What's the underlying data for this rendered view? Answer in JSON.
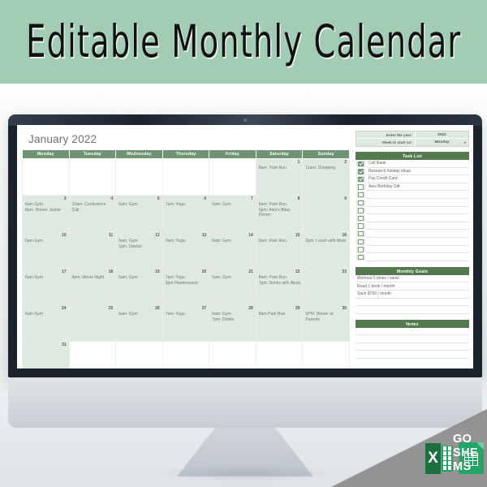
{
  "banner": {
    "title": "Editable Monthly Calendar",
    "background_color": "#a3ccb4"
  },
  "colors": {
    "banner_green": "#a3ccb4",
    "header_green": "#6f9373",
    "panel_head_green": "#55794f",
    "cell_tint_green": "#dfe9e0",
    "excel_green": "#1d6f42",
    "sheets_green": "#23a566"
  },
  "spreadsheet": {
    "month_title": "January 2022",
    "controls": [
      {
        "label": "Enter the year:",
        "value": "2022",
        "has_dropdown": false
      },
      {
        "label": "Week to start on:",
        "value": "Monday",
        "has_dropdown": true
      }
    ],
    "day_headers": [
      "Monday",
      "Tuesday",
      "Wednesday",
      "Thursday",
      "Friday",
      "Saturday",
      "Sunday"
    ],
    "weeks": [
      [
        {
          "day": "",
          "events": [],
          "tint": false
        },
        {
          "day": "",
          "events": [],
          "tint": false
        },
        {
          "day": "",
          "events": [],
          "tint": false
        },
        {
          "day": "",
          "events": [],
          "tint": false
        },
        {
          "day": "",
          "events": [],
          "tint": false
        },
        {
          "day": "1",
          "events": [
            "8am: Park Run"
          ],
          "tint": true
        },
        {
          "day": "2",
          "events": [
            "11am: Shopping"
          ],
          "tint": true
        }
      ],
      [
        {
          "day": "3",
          "events": [
            "6am Gym",
            "8pm: Dinner Jackie"
          ],
          "tint": true
        },
        {
          "day": "4",
          "events": [
            "10am: Conference Call"
          ],
          "tint": true
        },
        {
          "day": "5",
          "events": [
            "6am: Gym"
          ],
          "tint": true
        },
        {
          "day": "6",
          "events": [
            "7am: Yoga"
          ],
          "tint": true
        },
        {
          "day": "7",
          "events": [
            "6am: Gym"
          ],
          "tint": true
        },
        {
          "day": "8",
          "events": [
            "8am: Park Run",
            "6pm: Alex's Bday Dinner"
          ],
          "tint": true
        },
        {
          "day": "9",
          "events": [],
          "tint": true
        }
      ],
      [
        {
          "day": "10",
          "events": [
            "6am Gym"
          ],
          "tint": true
        },
        {
          "day": "11",
          "events": [],
          "tint": true
        },
        {
          "day": "12",
          "events": [
            "6am: Gym",
            "1pm: Dentist"
          ],
          "tint": true
        },
        {
          "day": "13",
          "events": [
            "7am: Yoga"
          ],
          "tint": true
        },
        {
          "day": "14",
          "events": [
            "6am: Gym"
          ],
          "tint": true
        },
        {
          "day": "15",
          "events": [
            "8am: Park Run"
          ],
          "tint": true
        },
        {
          "day": "16",
          "events": [
            "2pm: Lunch with Mum"
          ],
          "tint": true
        }
      ],
      [
        {
          "day": "17",
          "events": [
            "6am Gym"
          ],
          "tint": true
        },
        {
          "day": "18",
          "events": [
            "6pm: Movie Night"
          ],
          "tint": true
        },
        {
          "day": "19",
          "events": [
            "6am: Gym"
          ],
          "tint": true
        },
        {
          "day": "20",
          "events": [
            "7am: Yoga",
            "2pm Hairdressers"
          ],
          "tint": true
        },
        {
          "day": "21",
          "events": [
            "6am: Gym"
          ],
          "tint": true
        },
        {
          "day": "22",
          "events": [
            "8am: Park Run",
            "7pm: Drinks with Alicia"
          ],
          "tint": true
        },
        {
          "day": "23",
          "events": [],
          "tint": true
        }
      ],
      [
        {
          "day": "24",
          "events": [
            "6am Gym"
          ],
          "tint": true
        },
        {
          "day": "25",
          "events": [],
          "tint": true
        },
        {
          "day": "26",
          "events": [
            "6am: Gym"
          ],
          "tint": true
        },
        {
          "day": "27",
          "events": [
            "7am: Yoga"
          ],
          "tint": true
        },
        {
          "day": "28",
          "events": [
            "6am: Gym",
            "7pm: Drinks"
          ],
          "tint": true
        },
        {
          "day": "29",
          "events": [
            "8am Park Run"
          ],
          "tint": true
        },
        {
          "day": "30",
          "events": [
            "5PM: Dinner at Parents"
          ],
          "tint": true
        }
      ],
      [
        {
          "day": "31",
          "events": [],
          "tint": true
        },
        {
          "day": "",
          "events": [],
          "tint": false
        },
        {
          "day": "",
          "events": [],
          "tint": false
        },
        {
          "day": "",
          "events": [],
          "tint": false
        },
        {
          "day": "",
          "events": [],
          "tint": false
        },
        {
          "day": "",
          "events": [],
          "tint": false
        },
        {
          "day": "",
          "events": [],
          "tint": false
        }
      ]
    ],
    "task_list": {
      "title": "Task List",
      "items": [
        {
          "text": "Call Bank",
          "checked": true
        },
        {
          "text": "Research holiday ideas",
          "checked": true
        },
        {
          "text": "Pay Credit Card",
          "checked": true
        },
        {
          "text": "Alex Birthday Gift",
          "checked": false
        },
        {
          "text": "",
          "checked": false
        },
        {
          "text": "",
          "checked": false
        },
        {
          "text": "",
          "checked": false
        },
        {
          "text": "",
          "checked": false
        },
        {
          "text": "",
          "checked": false
        },
        {
          "text": "",
          "checked": false
        },
        {
          "text": "",
          "checked": false
        },
        {
          "text": "",
          "checked": false
        },
        {
          "text": "",
          "checked": false
        }
      ]
    },
    "monthly_goals": {
      "title": "Monthly Goals",
      "items": [
        "Workout 5 times / week",
        "Read 1 book / month",
        "Save $750 / month",
        "",
        ""
      ]
    },
    "notes": {
      "title": "Notes",
      "items": [
        "",
        "",
        "",
        ""
      ]
    }
  },
  "ribbon": {
    "lines": [
      "GO",
      "SHE",
      "MS"
    ],
    "excel_letter": "X"
  }
}
